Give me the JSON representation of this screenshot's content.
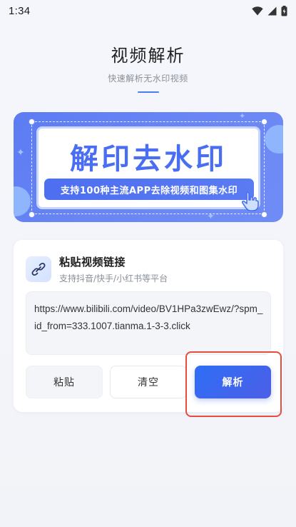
{
  "status_bar": {
    "time": "1:34",
    "icons": [
      "wifi-icon",
      "signal-icon",
      "battery-icon"
    ]
  },
  "header": {
    "title": "视频解析",
    "subtitle": "快速解析无水印视频",
    "accent_color": "#4a7df0"
  },
  "banner": {
    "headline": "解印去水印",
    "tagline": "支持100种主流APP去除视频和图集水印",
    "colors": {
      "background": "#6a86f4",
      "headline": "#4a6ef2",
      "pill": "#4d6ff0"
    }
  },
  "card": {
    "icon": "link-icon",
    "title": "粘贴视频链接",
    "subtitle": "支持抖音/快手/小红书等平台",
    "url_value": "https://www.bilibili.com/video/BV1HPa3zwEwz/?spm_id_from=333.1007.tianma.1-3-3.click",
    "buttons": {
      "paste": "粘贴",
      "clear": "清空",
      "parse": "解析"
    },
    "colors": {
      "parse_button": "#2f6ef6",
      "highlight": "#e74c3c"
    }
  }
}
